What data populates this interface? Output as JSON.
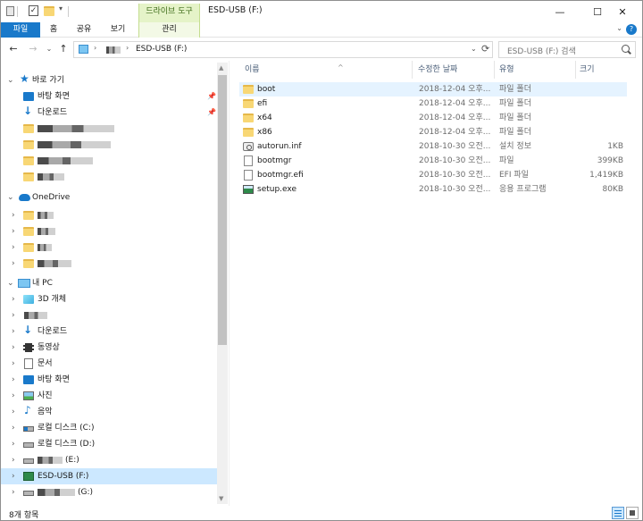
{
  "window": {
    "title": "ESD-USB (F:)",
    "context_tab": "드라이브 도구",
    "minimize": "—",
    "maximize": "☐",
    "close": "✕"
  },
  "ribbon": {
    "tabs": [
      "파일",
      "홈",
      "공유",
      "보기",
      "관리"
    ],
    "toggle": "⌄",
    "help": "?"
  },
  "address": {
    "back": "←",
    "forward": "→",
    "recent": "⌄",
    "up": "↑",
    "sep": "›",
    "crumb": "ESD-USB (F:)",
    "dropdown": "⌄",
    "refresh": "⟳",
    "search_placeholder": "ESD-USB (F:) 검색"
  },
  "nav": {
    "quick_access": "바로 가기",
    "desktop": "바탕 화면",
    "downloads": "다운로드",
    "onedrive": "OneDrive",
    "this_pc": "내 PC",
    "objects3d": "3D 개체",
    "downloads2": "다운로드",
    "videos": "동영상",
    "documents": "문서",
    "desktop2": "바탕 화면",
    "pictures": "사진",
    "music": "음악",
    "local_c": "로컬 디스크 (C:)",
    "local_d": "로컬 디스크 (D:)",
    "drive_e": "(E:)",
    "esd_usb": "ESD-USB (F:)",
    "drive_g": "(G:)",
    "pin": "📌",
    "chev_open": "⌄",
    "chev_closed": "›"
  },
  "columns": {
    "name": "이름",
    "date": "수정한 날짜",
    "type": "유형",
    "size": "크기",
    "sort": "^"
  },
  "files": [
    {
      "name": "boot",
      "date": "2018-12-04 오후...",
      "type": "파일 폴더",
      "size": "",
      "icon": "folder-icon"
    },
    {
      "name": "efi",
      "date": "2018-12-04 오후...",
      "type": "파일 폴더",
      "size": "",
      "icon": "folder-icon"
    },
    {
      "name": "x64",
      "date": "2018-12-04 오후...",
      "type": "파일 폴더",
      "size": "",
      "icon": "folder-icon"
    },
    {
      "name": "x86",
      "date": "2018-12-04 오후...",
      "type": "파일 폴더",
      "size": "",
      "icon": "folder-icon"
    },
    {
      "name": "autorun.inf",
      "date": "2018-10-30 오전...",
      "type": "설치 정보",
      "size": "1KB",
      "icon": "settings-file-icon"
    },
    {
      "name": "bootmgr",
      "date": "2018-10-30 오전...",
      "type": "파일",
      "size": "399KB",
      "icon": "file-icon"
    },
    {
      "name": "bootmgr.efi",
      "date": "2018-10-30 오전...",
      "type": "EFI 파일",
      "size": "1,419KB",
      "icon": "file-icon"
    },
    {
      "name": "setup.exe",
      "date": "2018-10-30 오전...",
      "type": "응용 프로그램",
      "size": "80KB",
      "icon": "application-icon"
    }
  ],
  "status": {
    "count": "8개 항목"
  }
}
